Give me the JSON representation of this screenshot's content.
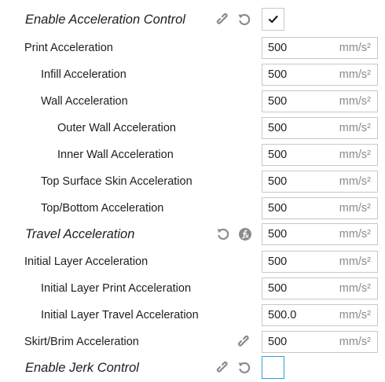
{
  "settings": {
    "enable_accel": {
      "label": "Enable Acceleration Control",
      "checked": true
    },
    "print_accel": {
      "label": "Print Acceleration",
      "value": "500",
      "unit": "mm/s²"
    },
    "infill_accel": {
      "label": "Infill Acceleration",
      "value": "500",
      "unit": "mm/s²"
    },
    "wall_accel": {
      "label": "Wall Acceleration",
      "value": "500",
      "unit": "mm/s²"
    },
    "outer_wall_accel": {
      "label": "Outer Wall Acceleration",
      "value": "500",
      "unit": "mm/s²"
    },
    "inner_wall_accel": {
      "label": "Inner Wall Acceleration",
      "value": "500",
      "unit": "mm/s²"
    },
    "top_surface_accel": {
      "label": "Top Surface Skin Acceleration",
      "value": "500",
      "unit": "mm/s²"
    },
    "top_bottom_accel": {
      "label": "Top/Bottom Acceleration",
      "value": "500",
      "unit": "mm/s²"
    },
    "travel_accel": {
      "label": "Travel Acceleration",
      "value": "500",
      "unit": "mm/s²"
    },
    "initial_layer_accel": {
      "label": "Initial Layer Acceleration",
      "value": "500",
      "unit": "mm/s²"
    },
    "initial_layer_print_accel": {
      "label": "Initial Layer Print Acceleration",
      "value": "500",
      "unit": "mm/s²"
    },
    "initial_layer_travel_accel": {
      "label": "Initial Layer Travel Acceleration",
      "value": "500.0",
      "unit": "mm/s²"
    },
    "skirt_brim_accel": {
      "label": "Skirt/Brim Acceleration",
      "value": "500",
      "unit": "mm/s²"
    },
    "enable_jerk": {
      "label": "Enable Jerk Control",
      "checked": false
    }
  },
  "colors": {
    "icon_gray": "#8c8c8c",
    "checkbox_focus_border": "#2aa6d6",
    "field_border": "#c8c8c8",
    "unit_text": "#8a8a8a"
  },
  "icons": {
    "link": "link-icon",
    "reset": "reset-icon",
    "formula": "formula-icon",
    "check": "checkmark-icon"
  }
}
